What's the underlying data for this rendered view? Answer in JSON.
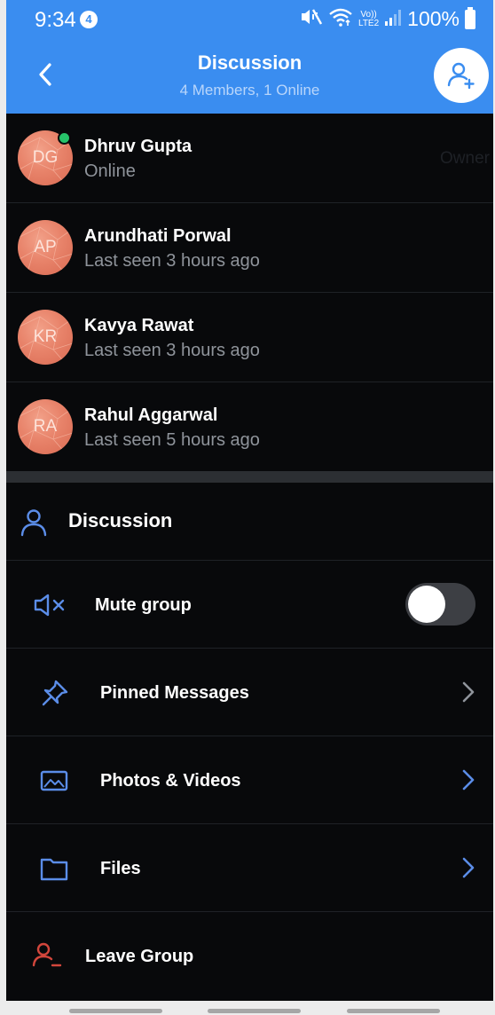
{
  "status_bar": {
    "time": "9:34",
    "notification_count": "4",
    "network_label_top": "Vo))",
    "network_label_bottom": "LTE2",
    "battery": "100%"
  },
  "header": {
    "title": "Discussion",
    "subtitle": "4 Members, 1 Online",
    "back_icon": "chevron-left-icon",
    "add_icon": "add-user-icon"
  },
  "members": [
    {
      "initials": "DG",
      "name": "Dhruv Gupta",
      "status": "Online",
      "online": true,
      "tag": "Owner"
    },
    {
      "initials": "AP",
      "name": "Arundhati Porwal",
      "status": "Last seen 3 hours ago",
      "online": false,
      "tag": ""
    },
    {
      "initials": "KR",
      "name": "Kavya Rawat",
      "status": "Last seen 3 hours ago",
      "online": false,
      "tag": ""
    },
    {
      "initials": "RA",
      "name": "Rahul Aggarwal",
      "status": "Last seen 5 hours ago",
      "online": false,
      "tag": ""
    }
  ],
  "settings": {
    "section_title": "Discussion",
    "mute_label": "Mute group",
    "mute_enabled": false,
    "pinned_label": "Pinned Messages",
    "media_label": "Photos & Videos",
    "files_label": "Files",
    "leave_label": "Leave Group"
  },
  "colors": {
    "accent": "#3a8df0",
    "background": "#08090b",
    "online": "#27c36a",
    "icon_blue": "#5b8de8",
    "danger": "#d2463c",
    "secondary_text": "#8f949b"
  }
}
